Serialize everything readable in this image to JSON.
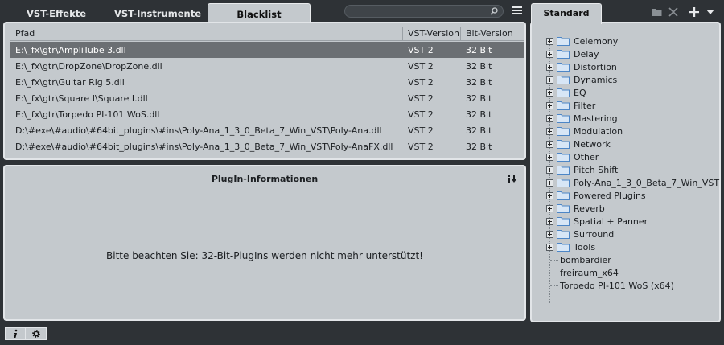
{
  "tabs": [
    {
      "label": "VST-Effekte",
      "active": false
    },
    {
      "label": "VST-Instrumente",
      "active": false
    },
    {
      "label": "Blacklist",
      "active": true
    }
  ],
  "search": {
    "placeholder": ""
  },
  "table": {
    "columns": [
      "Pfad",
      "VST-Version",
      "Bit-Version"
    ],
    "rows": [
      {
        "path": "E:\\_fx\\gtr\\AmpliTube 3.dll",
        "vst": "VST 2",
        "bit": "32 Bit",
        "selected": true
      },
      {
        "path": "E:\\_fx\\gtr\\DropZone\\DropZone.dll",
        "vst": "VST 2",
        "bit": "32 Bit"
      },
      {
        "path": "E:\\_fx\\gtr\\Guitar Rig 5.dll",
        "vst": "VST 2",
        "bit": "32 Bit"
      },
      {
        "path": "E:\\_fx\\gtr\\Square I\\Square I.dll",
        "vst": "VST 2",
        "bit": "32 Bit"
      },
      {
        "path": "E:\\_fx\\gtr\\Torpedo PI-101 WoS.dll",
        "vst": "VST 2",
        "bit": "32 Bit"
      },
      {
        "path": "D:\\#exe\\#audio\\#64bit_plugins\\#ins\\Poly-Ana_1_3_0_Beta_7_Win_VST\\Poly-Ana.dll",
        "vst": "VST 2",
        "bit": "32 Bit"
      },
      {
        "path": "D:\\#exe\\#audio\\#64bit_plugins\\#ins\\Poly-Ana_1_3_0_Beta_7_Win_VST\\Poly-AnaFX.dll",
        "vst": "VST 2",
        "bit": "32 Bit"
      }
    ]
  },
  "info": {
    "title": "PlugIn-Informationen",
    "message": "Bitte beachten Sie: 32-Bit-PlugIns werden nicht mehr unterstützt!"
  },
  "right_tab": {
    "label": "Standard"
  },
  "tree": {
    "folders": [
      "Celemony",
      "Delay",
      "Distortion",
      "Dynamics",
      "EQ",
      "Filter",
      "Mastering",
      "Modulation",
      "Network",
      "Other",
      "Pitch Shift",
      "Poly-Ana_1_3_0_Beta_7_Win_VST",
      "Powered Plugins",
      "Reverb",
      "Spatial + Panner",
      "Surround",
      "Tools"
    ],
    "leaves": [
      "bombardier",
      "freiraum_x64",
      "Torpedo PI-101 WoS (x64)"
    ]
  },
  "colors": {
    "panel": "#c4c9cd",
    "background": "#2e3236",
    "selected_row": "#6b6f73",
    "folder": "#4d86c6"
  },
  "icons": [
    "search-icon",
    "menu-icon",
    "info-download-icon",
    "folder-icon",
    "close-icon",
    "plus-icon",
    "dropdown-icon",
    "info-icon",
    "gear-icon"
  ]
}
